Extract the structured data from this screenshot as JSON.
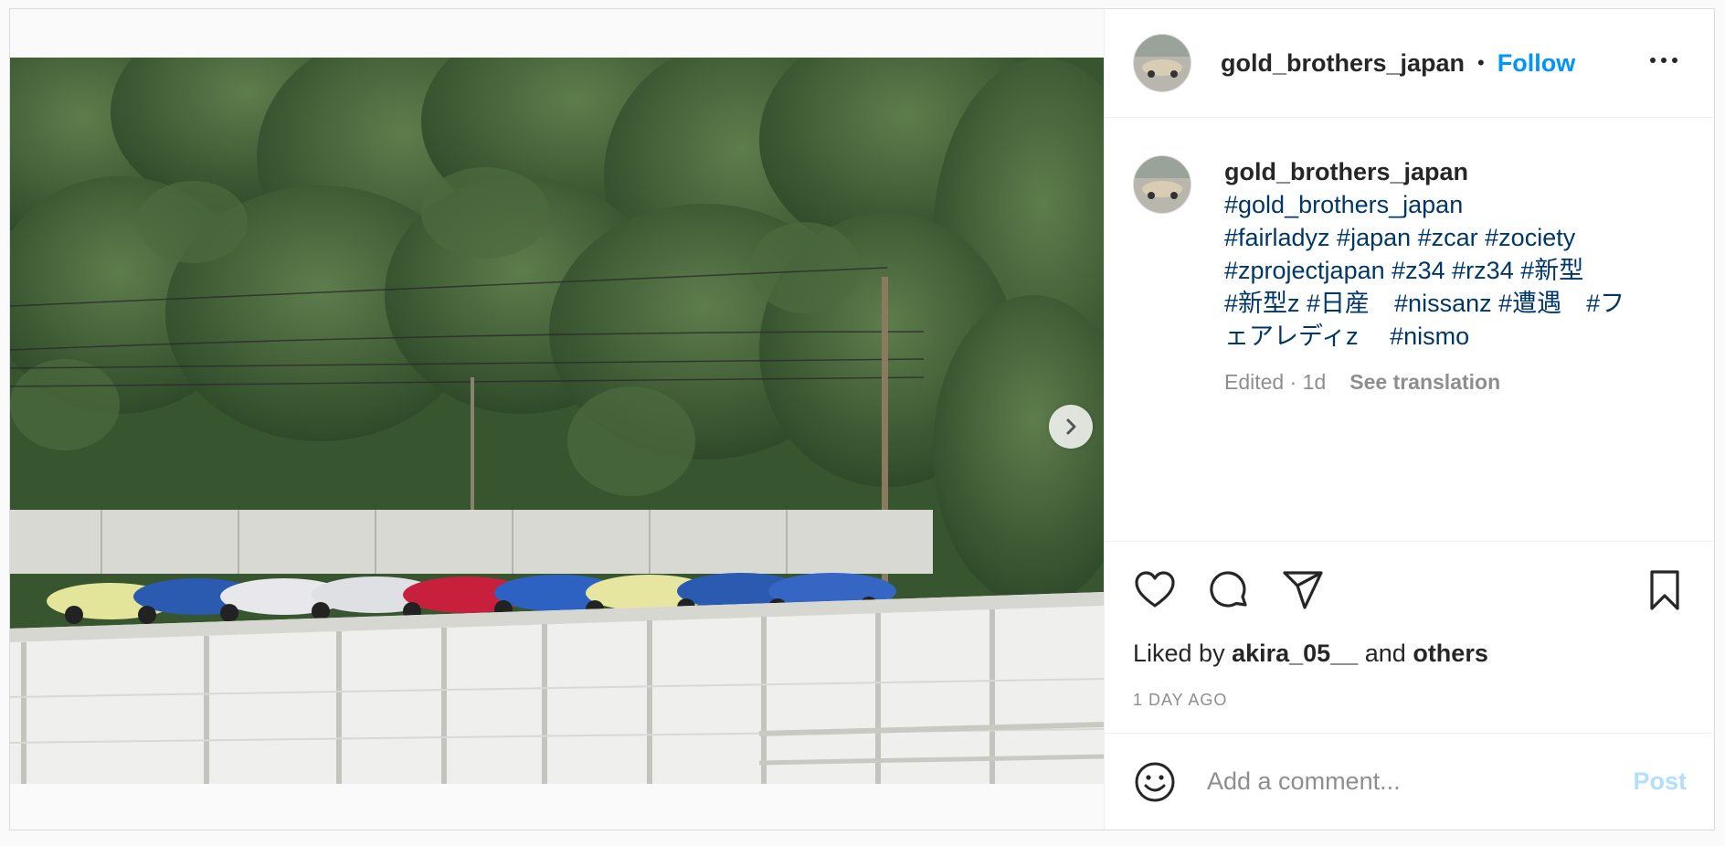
{
  "post": {
    "author": {
      "username": "gold_brothers_japan"
    },
    "header": {
      "follow_label": "Follow",
      "separator": "•"
    },
    "caption": {
      "username": "gold_brothers_japan",
      "hashtags": "#gold_brothers_japan\n#fairladyz #japan #zcar #zociety\n#zprojectjapan #z34 #rz34 #新型\n#新型z #日産　#nissanz #遭遇　#フ\nェアレディz　 #nismo",
      "edited_meta": "Edited · 1d",
      "see_translation_label": "See translation"
    },
    "likes": {
      "prefix": "Liked by",
      "user": "akira_05__",
      "conjunction": "and",
      "others": "others"
    },
    "age": "1 DAY AGO",
    "comment": {
      "placeholder": "Add a comment...",
      "post_label": "Post"
    }
  },
  "icons": {
    "carousel_next": "chevron-right-icon",
    "more": "more-options-icon",
    "like": "heart-icon",
    "comment": "comment-icon",
    "share": "paper-plane-icon",
    "save": "bookmark-icon",
    "emoji": "smiley-icon"
  },
  "colors": {
    "accent": "#0095f6",
    "hashtag": "#00376b",
    "muted": "#8e8e8e",
    "post_disabled": "#b2dffc"
  }
}
